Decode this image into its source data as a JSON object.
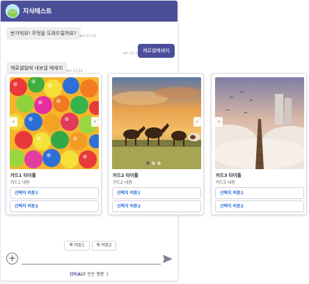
{
  "header": {
    "title": "지식테스트",
    "avatar_icon": "bot-avatar-icon"
  },
  "messages": [
    {
      "from": "bot",
      "text": "반가워요! 무엇을 도와드릴까요?",
      "time": "am 11:11"
    },
    {
      "from": "user",
      "text": "캐로셀메세지",
      "time": "am 11:11"
    },
    {
      "from": "bot",
      "text": "캐로셀일때 내보낼 메세지",
      "time": "am 11:11"
    }
  ],
  "cards": [
    {
      "title": "카드1 타이틀",
      "desc": "카드1 내용",
      "buttons": [
        "선택지 버튼1",
        "선택지 버튼2"
      ],
      "image": "colorful-balls"
    },
    {
      "title": "카드2 타이틀",
      "desc": "카드2 내용",
      "buttons": [
        "선택지 버튼1",
        "선택지 버튼2"
      ],
      "image": "horses-sunset"
    },
    {
      "title": "카드3 타이틀",
      "desc": "카드3 내용",
      "buttons": [
        "선택지 버튼1",
        "선택지 버튼2"
      ],
      "image": "sky-path"
    }
  ],
  "quick_replies": [
    "퀵 버튼1",
    "퀵 버튼2"
  ],
  "input": {
    "plus_icon": "plus-icon",
    "send_icon": "send-icon"
  },
  "footer": {
    "brand": "단비Ai",
    "text": "로 만든 챗봇 :)"
  },
  "colors": {
    "primary": "#4b4f9a",
    "link": "#2b6fd6"
  }
}
